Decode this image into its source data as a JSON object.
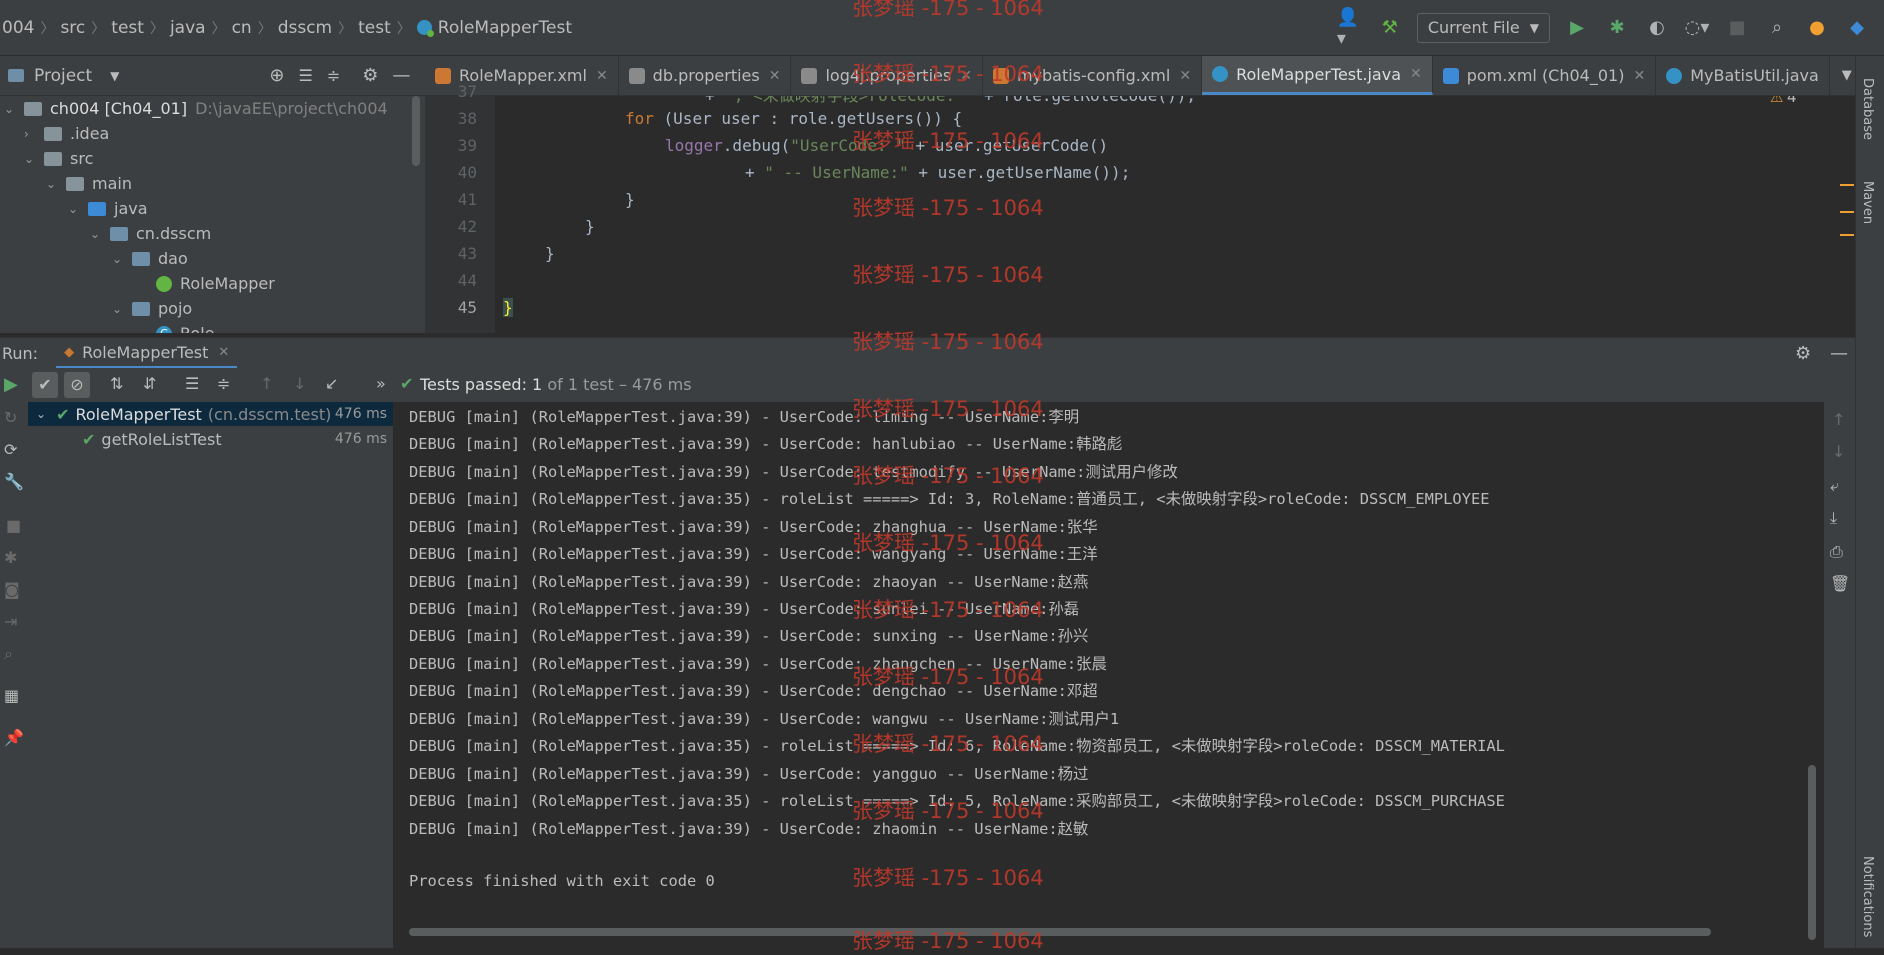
{
  "breadcrumbs": [
    "004",
    "src",
    "test",
    "java",
    "cn",
    "dsscm",
    "test",
    "RoleMapperTest"
  ],
  "run_config": "Current File",
  "project_panel": {
    "title": "Project"
  },
  "editor_tabs": [
    {
      "label": "RoleMapper.xml",
      "color": "#cc7832",
      "active": false
    },
    {
      "label": "db.properties",
      "color": "#8a8a8a",
      "active": false
    },
    {
      "label": "log4j.properties",
      "color": "#8a8a8a",
      "active": false
    },
    {
      "label": "mybatis-config.xml",
      "color": "#cc7832",
      "active": false
    },
    {
      "label": "RoleMapperTest.java",
      "color": "#3592c4",
      "active": true
    },
    {
      "label": "pom.xml (Ch04_01)",
      "color": "#3d8bd6",
      "active": false
    },
    {
      "label": "MyBatisUtil.java",
      "color": "#3592c4",
      "active": false
    }
  ],
  "tree": {
    "root_label": "ch004 [Ch04_01]",
    "root_path": "D:\\javaEE\\project\\ch004",
    "items": [
      ".idea",
      "src",
      "main",
      "java",
      "cn.dsscm",
      "dao",
      "RoleMapper",
      "pojo",
      "Role"
    ]
  },
  "editor": {
    "line_numbers": [
      "37",
      "38",
      "39",
      "40",
      "41",
      "42",
      "43",
      "44",
      "45"
    ],
    "warning_count": "4"
  },
  "run_panel": {
    "label": "Run:",
    "tab": "RoleMapperTest",
    "status": "Tests passed:",
    "status_count": "1",
    "status_detail": "of 1 test – 476 ms",
    "suite_name": "RoleMapperTest",
    "suite_pkg": "(cn.dsscm.test)",
    "suite_time": "476 ms",
    "test_name": "getRoleListTest",
    "test_time": "476 ms"
  },
  "console_lines": [
    "DEBUG [main] (RoleMapperTest.java:39) - UserCode: liming -- UserName:李明",
    "DEBUG [main] (RoleMapperTest.java:39) - UserCode: hanlubiao -- UserName:韩路彪",
    "DEBUG [main] (RoleMapperTest.java:39) - UserCode: testmodify -- UserName:测试用户修改",
    "DEBUG [main] (RoleMapperTest.java:35) - roleList =====> Id: 3, RoleName:普通员工, <未做映射字段>roleCode: DSSCM_EMPLOYEE",
    "DEBUG [main] (RoleMapperTest.java:39) - UserCode: zhanghua -- UserName:张华",
    "DEBUG [main] (RoleMapperTest.java:39) - UserCode: wangyang -- UserName:王洋",
    "DEBUG [main] (RoleMapperTest.java:39) - UserCode: zhaoyan -- UserName:赵燕",
    "DEBUG [main] (RoleMapperTest.java:39) - UserCode: sunlei -- UserName:孙磊",
    "DEBUG [main] (RoleMapperTest.java:39) - UserCode: sunxing -- UserName:孙兴",
    "DEBUG [main] (RoleMapperTest.java:39) - UserCode: zhangchen -- UserName:张晨",
    "DEBUG [main] (RoleMapperTest.java:39) - UserCode: dengchao -- UserName:邓超",
    "DEBUG [main] (RoleMapperTest.java:39) - UserCode: wangwu -- UserName:测试用户1",
    "DEBUG [main] (RoleMapperTest.java:35) - roleList =====> Id: 6, RoleName:物资部员工, <未做映射字段>roleCode: DSSCM_MATERIAL",
    "DEBUG [main] (RoleMapperTest.java:39) - UserCode: yangguo -- UserName:杨过",
    "DEBUG [main] (RoleMapperTest.java:35) - roleList =====> Id: 5, RoleName:采购部员工, <未做映射字段>roleCode: DSSCM_PURCHASE",
    "DEBUG [main] (RoleMapperTest.java:39) - UserCode: zhaomin -- UserName:赵敏",
    "",
    "Process finished with exit code 0"
  ],
  "watermark": "张梦瑶 -175 - 1064",
  "side_labels": {
    "database": "Database",
    "maven": "Maven",
    "notifications": "Notifications"
  },
  "colors": {
    "accent": "#4a88c7",
    "success": "#59a869",
    "watermark": "#c0392b"
  }
}
